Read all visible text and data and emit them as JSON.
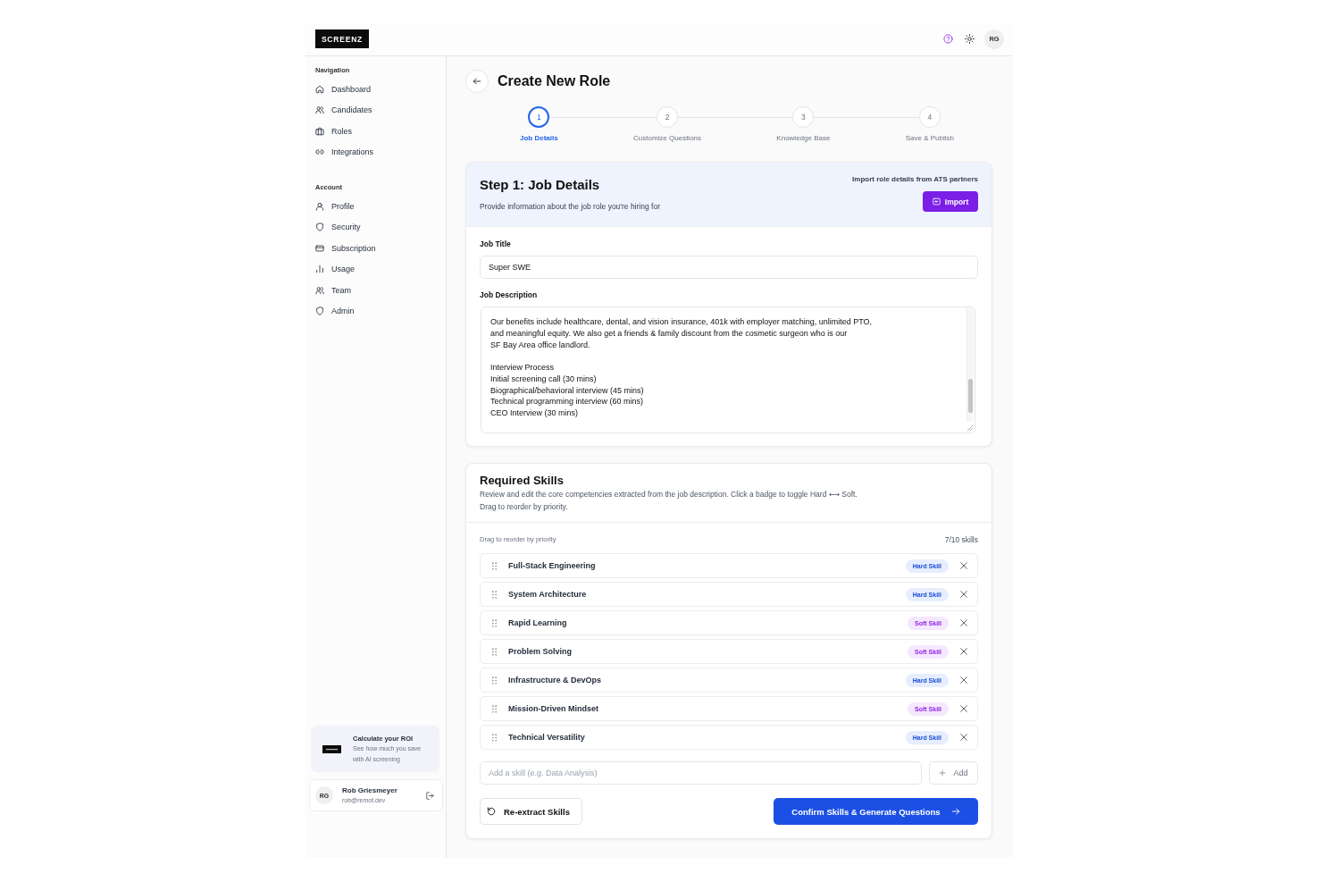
{
  "header": {
    "logo": "SCREENZ",
    "avatar": "RG"
  },
  "sidebar": {
    "sections": [
      {
        "heading": "Navigation",
        "items": [
          {
            "label": "Dashboard",
            "selected": false
          },
          {
            "label": "Candidates",
            "selected": false
          },
          {
            "label": "Roles",
            "selected": false
          },
          {
            "label": "Integrations",
            "selected": false
          }
        ]
      },
      {
        "heading": "Account",
        "items": [
          {
            "label": "Profile",
            "selected": false
          },
          {
            "label": "Security",
            "selected": false
          },
          {
            "label": "Subscription",
            "selected": false
          },
          {
            "label": "Usage",
            "selected": false
          },
          {
            "label": "Team",
            "selected": false
          },
          {
            "label": "Admin",
            "selected": false
          }
        ]
      }
    ],
    "promo": {
      "title": "Calculate your ROI",
      "text": "See how much you save with AI screening"
    },
    "user": {
      "initials": "RG",
      "name": "Rob Griesmeyer",
      "email": "rob@remot.dev"
    }
  },
  "page": {
    "title": "Create New Role"
  },
  "stepper": [
    {
      "number": "1",
      "label": "Job Details",
      "selected": true
    },
    {
      "number": "2",
      "label": "Customize Questions",
      "selected": false
    },
    {
      "number": "3",
      "label": "Knowledge Base",
      "selected": false
    },
    {
      "number": "4",
      "label": "Save & Publish",
      "selected": false
    }
  ],
  "details_card": {
    "title": "Step 1: Job Details",
    "subtitle": "Provide information about the job role you're hiring for",
    "import_hint": "Import role details from ATS partners",
    "import_button": "Import",
    "fields": [
      {
        "kind": "input",
        "label": "Job Title",
        "value": "Super SWE"
      },
      {
        "kind": "textarea",
        "label": "Job Description",
        "value": "Our benefits include healthcare, dental, and vision insurance, 401k with employer matching, unlimited PTO,\nand meaningful equity. We also get a friends & family discount from the cosmetic surgeon who is our\nSF Bay Area office landlord.\n\nInterview Process\nInitial screening call (30 mins)\nBiographical/behavioral interview (45 mins)\nTechnical programming interview (60 mins)\nCEO Interview (30 mins)"
      }
    ]
  },
  "skills_card": {
    "title": "Required Skills",
    "description": [
      "Review and edit the core competencies extracted from the job description. Click a badge to toggle Hard ⟷ Soft.",
      "Drag to reorder by priority."
    ],
    "list_hint": "Drag to reorder by priority",
    "count": "7/10 skills",
    "skills": [
      {
        "name": "Full-Stack Engineering",
        "kind": "hard",
        "badge": "Hard Skill"
      },
      {
        "name": "System Architecture",
        "kind": "hard",
        "badge": "Hard Skill"
      },
      {
        "name": "Rapid Learning",
        "kind": "soft",
        "badge": "Soft Skill"
      },
      {
        "name": "Problem Solving",
        "kind": "soft",
        "badge": "Soft Skill"
      },
      {
        "name": "Infrastructure & DevOps",
        "kind": "hard",
        "badge": "Hard Skill"
      },
      {
        "name": "Mission-Driven Mindset",
        "kind": "soft",
        "badge": "Soft Skill"
      },
      {
        "name": "Technical Versatility",
        "kind": "hard",
        "badge": "Hard Skill"
      }
    ],
    "add_field": {
      "placeholder": "Add a skill (e.g. Data Analysis)"
    },
    "add_button": "Add",
    "reextract_button": "Re-extract Skills",
    "confirm_button": "Confirm Skills & Generate Questions"
  }
}
